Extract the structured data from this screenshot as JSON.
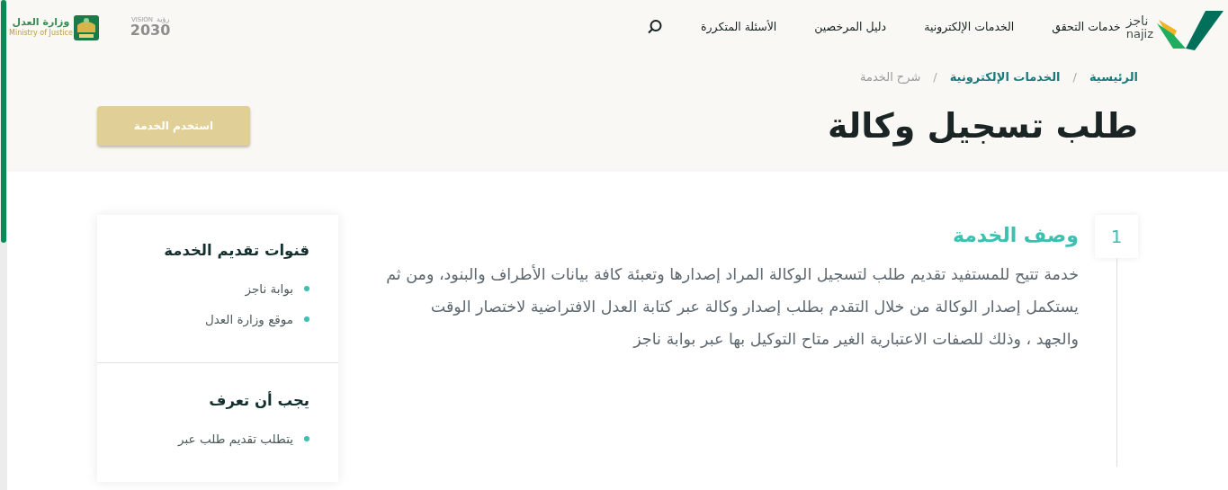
{
  "header": {
    "logo": {
      "arabic": "ناجز",
      "latin": "najiz"
    },
    "nav": [
      {
        "label": "خدمات التحقق"
      },
      {
        "label": "الخدمات الإلكترونية"
      },
      {
        "label": "دليل المرخصين"
      },
      {
        "label": "الأسئلة المتكررة"
      }
    ],
    "partner_logos": {
      "vision": {
        "label": "VISION",
        "arabic": "رؤية",
        "year": "2030"
      },
      "ministry": {
        "arabic": "وزارة العدل",
        "english": "Ministry of Justice"
      }
    }
  },
  "breadcrumb": [
    {
      "label": "الرئيسية",
      "current": false
    },
    {
      "separator": "/",
      "label": "الخدمات الإلكترونية",
      "current": false
    },
    {
      "separator": "/",
      "label": "شرح الخدمة",
      "current": true
    }
  ],
  "page_title": "طلب تسجيل وكالة",
  "action_button": "استخدم الخدمة",
  "steps": [
    {
      "number": "1",
      "title": "وصف الخدمة",
      "text": "خدمة تتيح للمستفيد تقديم طلب لتسجيل الوكالة المراد إصدارها وتعبئة كافة بيانات الأطراف والبنود، ومن ثم يستكمل إصدار الوكالة من خلال التقدم بطلب إصدار وكالة عبر كتابة العدل الافتراضية لاختصار الوقت والجهد ، وذلك للصفات الاعتبارية الغير متاح التوكيل بها عبر بوابة ناجز"
    }
  ],
  "sidebar": {
    "sections": [
      {
        "title": "قنوات تقديم الخدمة",
        "items": [
          "بوابة ناجز",
          "موقع وزارة العدل"
        ]
      },
      {
        "title": "يجب أن تعرف",
        "items": [
          "يتطلب تقديم طلب عبر"
        ]
      }
    ]
  }
}
